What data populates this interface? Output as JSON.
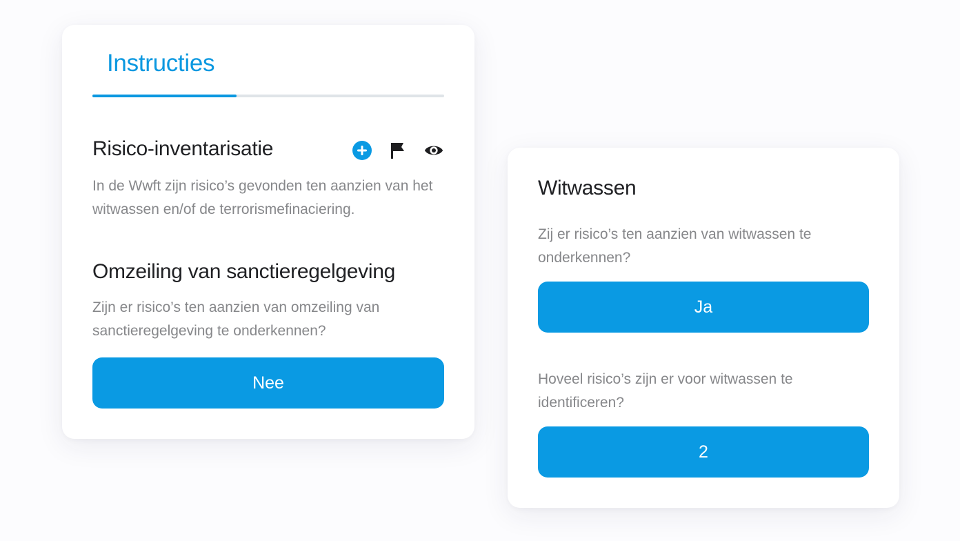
{
  "instructions_card": {
    "tab_label": "Instructies",
    "tab_progress": 0.41,
    "section_title": "Risico-inventarisatie",
    "section_text": "In de Wwft zijn risico’s gevonden ten aanzien van het witwassen en/of de terrorismefinaciering.",
    "icons": [
      "plus-circle-icon",
      "flag-icon",
      "eye-icon"
    ],
    "sanctions_title": "Omzeiling van sanctieregelgeving",
    "sanctions_question": "Zijn er risico’s ten aanzien van omzeiling van sanctieregelgeving te onderkennen?",
    "sanctions_answer": "Nee"
  },
  "money_laundering_card": {
    "title": "Witwassen",
    "question_1": "Zij er risico’s ten aanzien van witwassen te onderkennen?",
    "answer_1": "Ja",
    "question_2": "Hoveel risico’s zijn er voor witwassen te identificeren?",
    "answer_2": "2"
  },
  "colors": {
    "accent": "#0a9ae3",
    "title_text": "#202124",
    "body_text": "#86878a",
    "track": "#dfe4e8"
  }
}
